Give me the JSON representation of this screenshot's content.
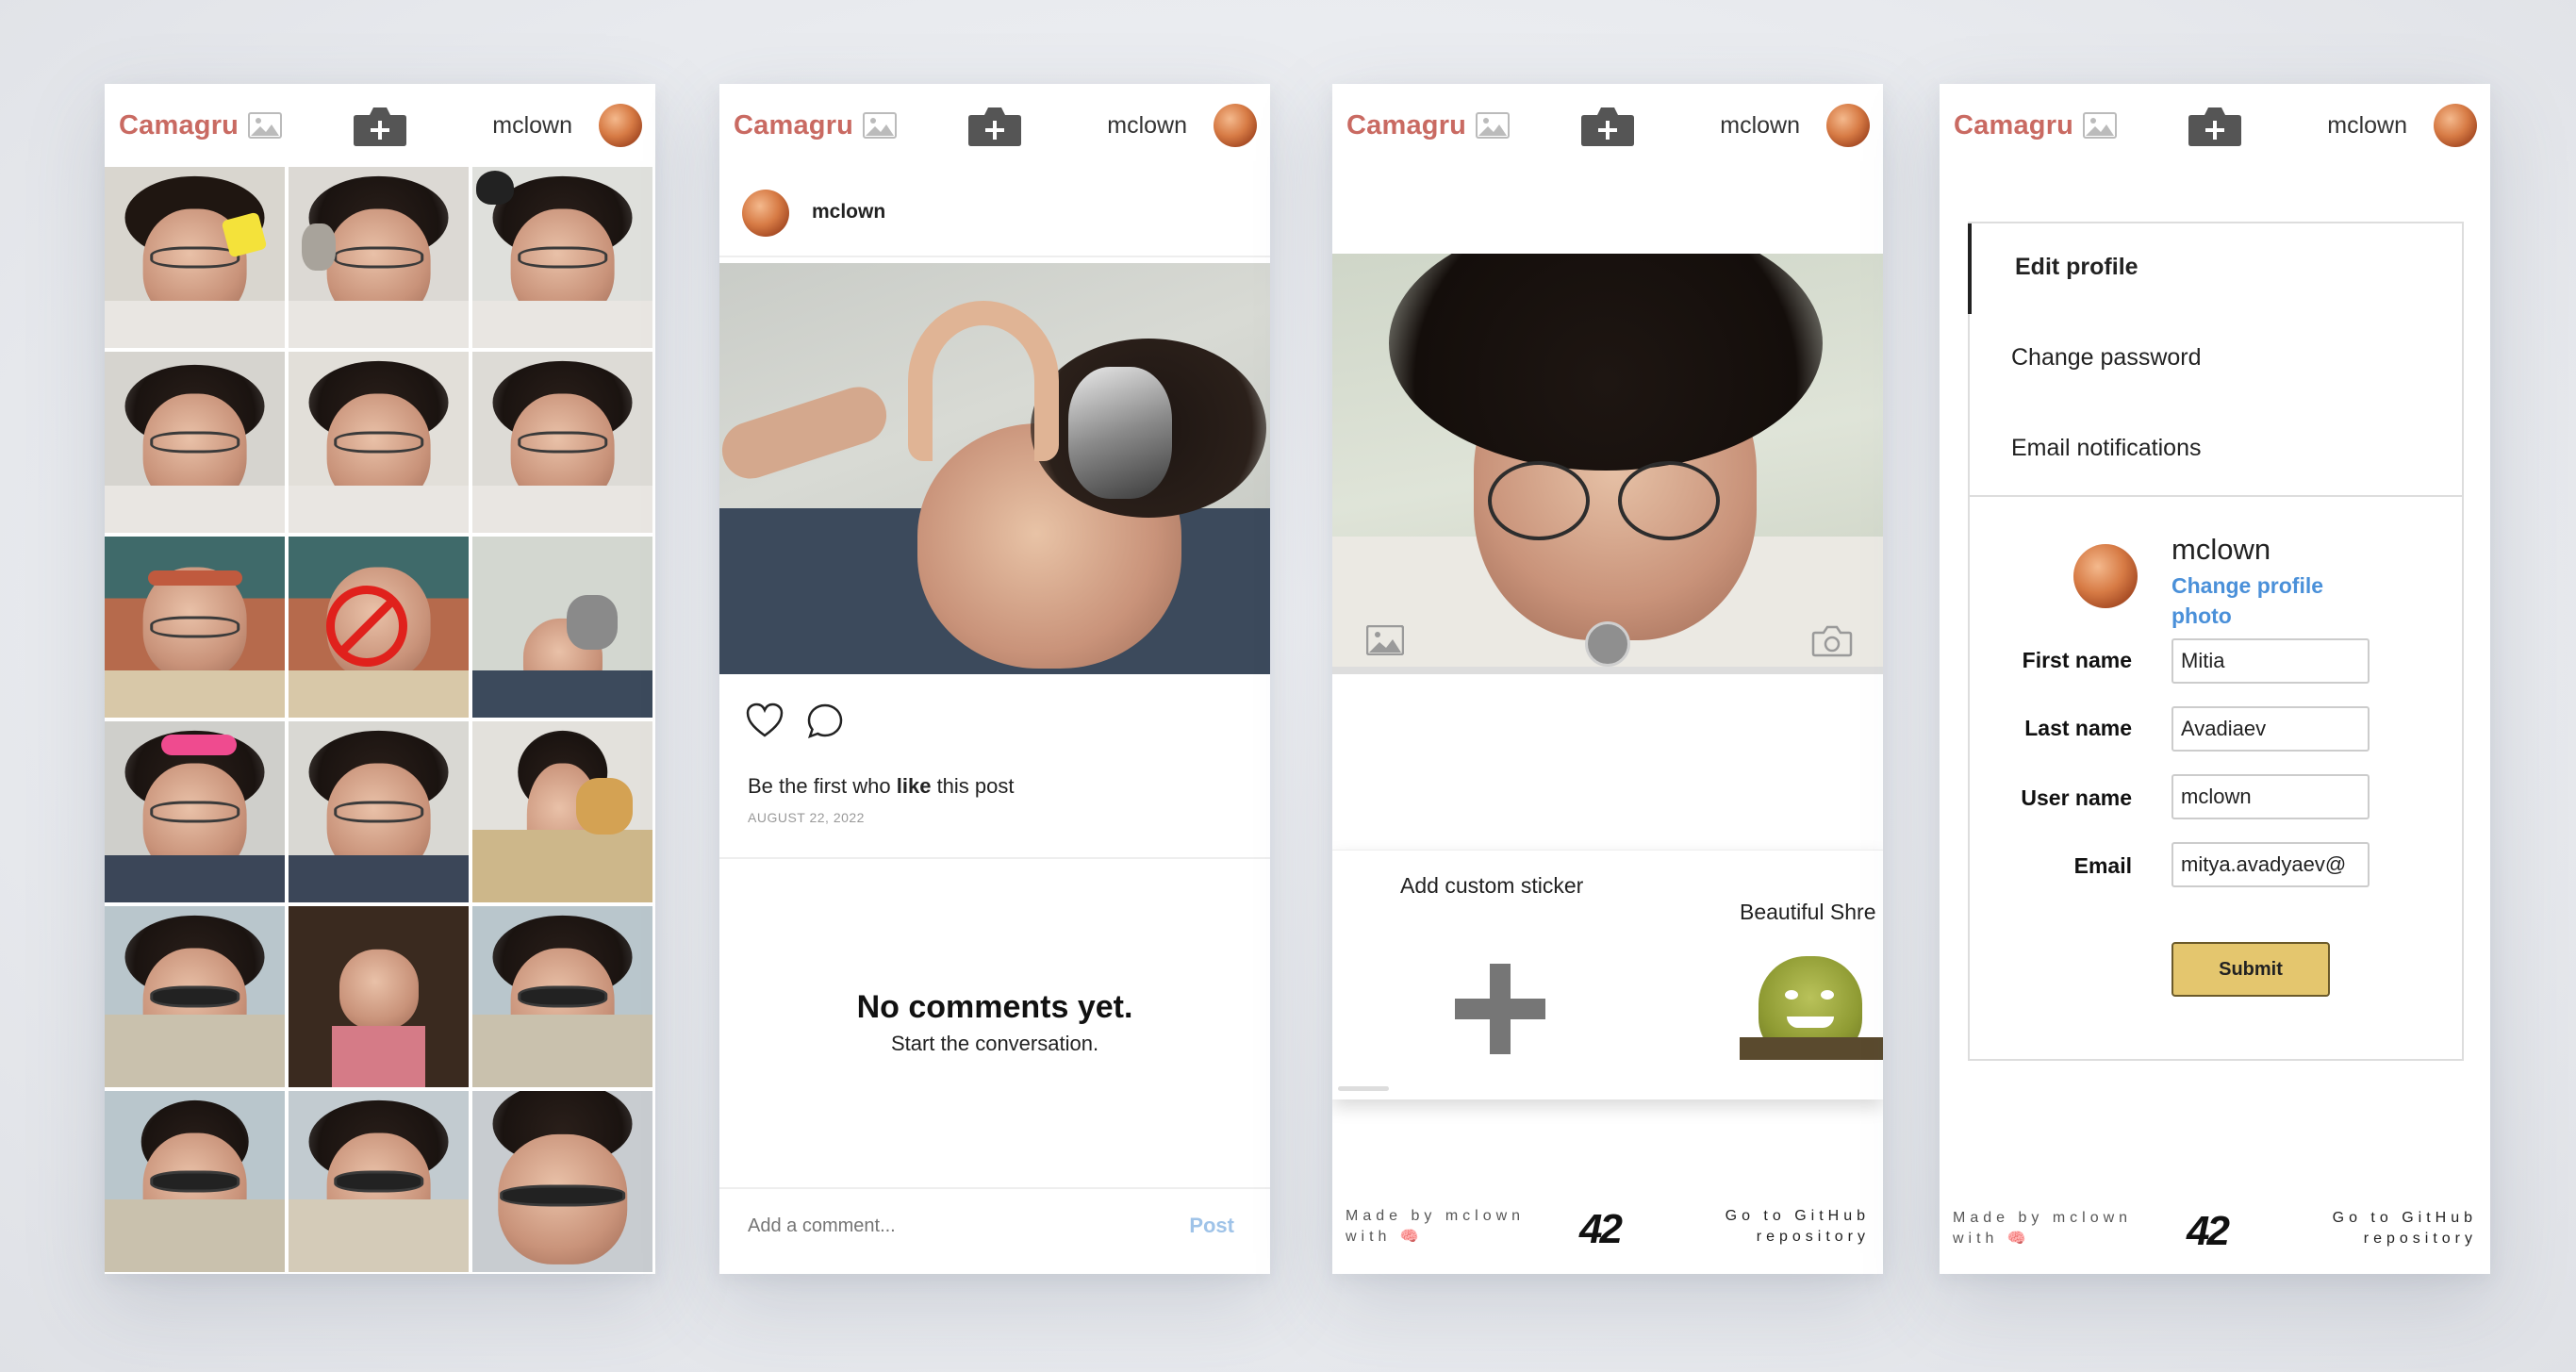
{
  "brand": {
    "logo_text": "Camagru",
    "accent_color": "#c96a62",
    "link_color": "#4a90d9",
    "submit_color": "#e4c66e"
  },
  "header": {
    "username": "mclown",
    "camera_icon": "camera-plus-icon",
    "gallery_icon": "image-icon"
  },
  "feed": {
    "tile_count": 15
  },
  "post": {
    "author": "mclown",
    "like_text_prefix": "Be the first who ",
    "like_text_bold": "like",
    "like_text_suffix": " this post",
    "date": "AUGUST 22, 2022",
    "no_comments_title": "No comments yet.",
    "no_comments_subtitle": "Start the conversation.",
    "comment_placeholder": "Add a comment...",
    "post_button": "Post"
  },
  "camera": {
    "add_sticker_label": "Add custom sticker",
    "sticker_name": "Beautiful Shre"
  },
  "footer": {
    "made_by_line1": "Made by mclown",
    "made_by_line2": "with 🧠",
    "logo": "42",
    "github_line1": "Go to GitHub",
    "github_line2": "repository"
  },
  "settings": {
    "menu": [
      "Edit profile",
      "Change password",
      "Email notifications"
    ],
    "username": "mclown",
    "change_photo": "Change profile photo",
    "fields": [
      {
        "label": "First name",
        "value": "Mitia"
      },
      {
        "label": "Last name",
        "value": "Avadiaev"
      },
      {
        "label": "User name",
        "value": "mclown"
      },
      {
        "label": "Email",
        "value": "mitya.avadyaev@"
      }
    ],
    "submit": "Submit"
  }
}
